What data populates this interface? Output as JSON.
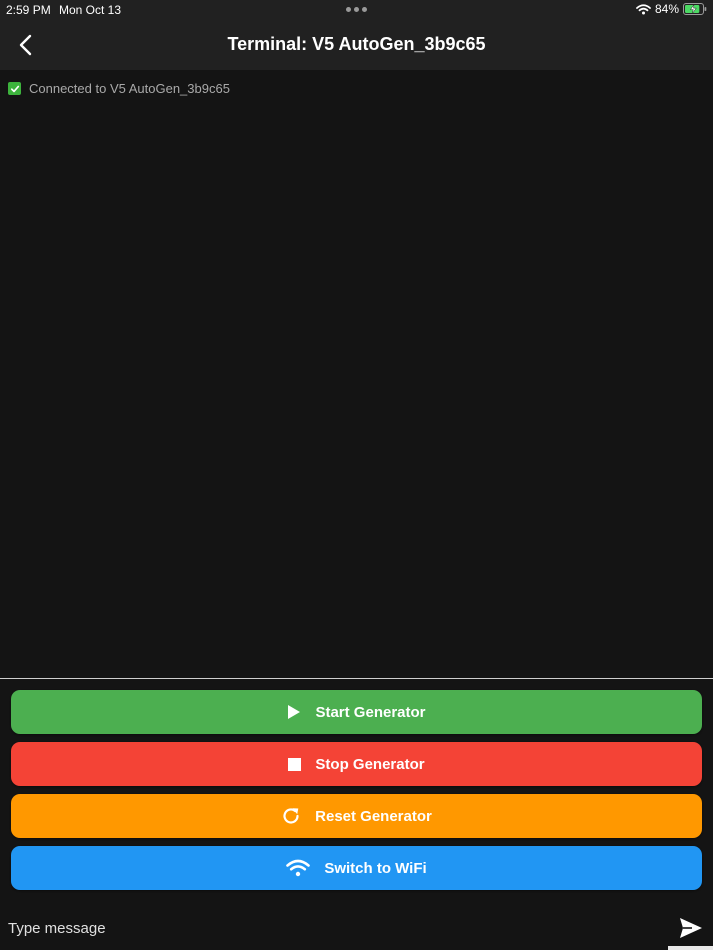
{
  "status_bar": {
    "time": "2:59 PM",
    "date": "Mon Oct 13",
    "battery_percent": "84%",
    "battery_level": 0.84,
    "icons": [
      "wifi-icon",
      "battery-charging-icon",
      "more-dots-icon"
    ]
  },
  "nav": {
    "title": "Terminal: V5 AutoGen_3b9c65",
    "back_icon": "chevron-left-icon"
  },
  "terminal": {
    "lines": [
      {
        "icon": "check-mark-icon",
        "text": "Connected to V5 AutoGen_3b9c65"
      }
    ]
  },
  "buttons": {
    "start": {
      "label": "Start Generator",
      "icon": "play-icon",
      "color": "#4caf50"
    },
    "stop": {
      "label": "Stop Generator",
      "icon": "stop-icon",
      "color": "#f44336"
    },
    "reset": {
      "label": "Reset Generator",
      "icon": "refresh-icon",
      "color": "#ff9800"
    },
    "wifi": {
      "label": "Switch to WiFi",
      "icon": "wifi-icon",
      "color": "#2196f3"
    }
  },
  "input": {
    "placeholder": "Type message",
    "value": "",
    "send_icon": "send-icon"
  }
}
